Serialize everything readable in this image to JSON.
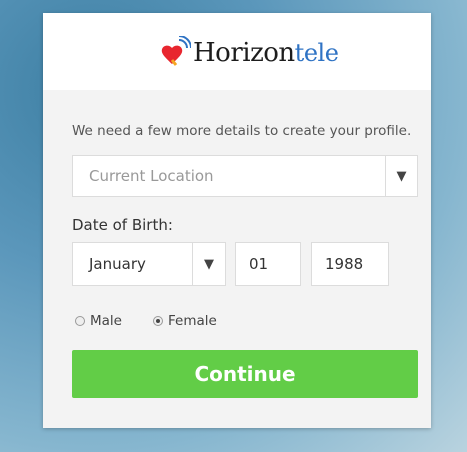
{
  "brand": {
    "name_main": "Horizon",
    "name_accent": "tele",
    "heart_color": "#e8262f",
    "accent_color": "#2f73c4",
    "icon": "heart-signal-icon"
  },
  "form": {
    "intro": "We need a few more details to create your profile.",
    "location": {
      "placeholder": "Current Location",
      "caret": "▼"
    },
    "dob": {
      "label": "Date of Birth:",
      "month": "January",
      "caret": "▼",
      "day": "01",
      "year": "1988"
    },
    "gender": {
      "male_label": "Male",
      "female_label": "Female",
      "selected": "Female"
    },
    "continue_label": "Continue",
    "button_color": "#62cd47"
  }
}
